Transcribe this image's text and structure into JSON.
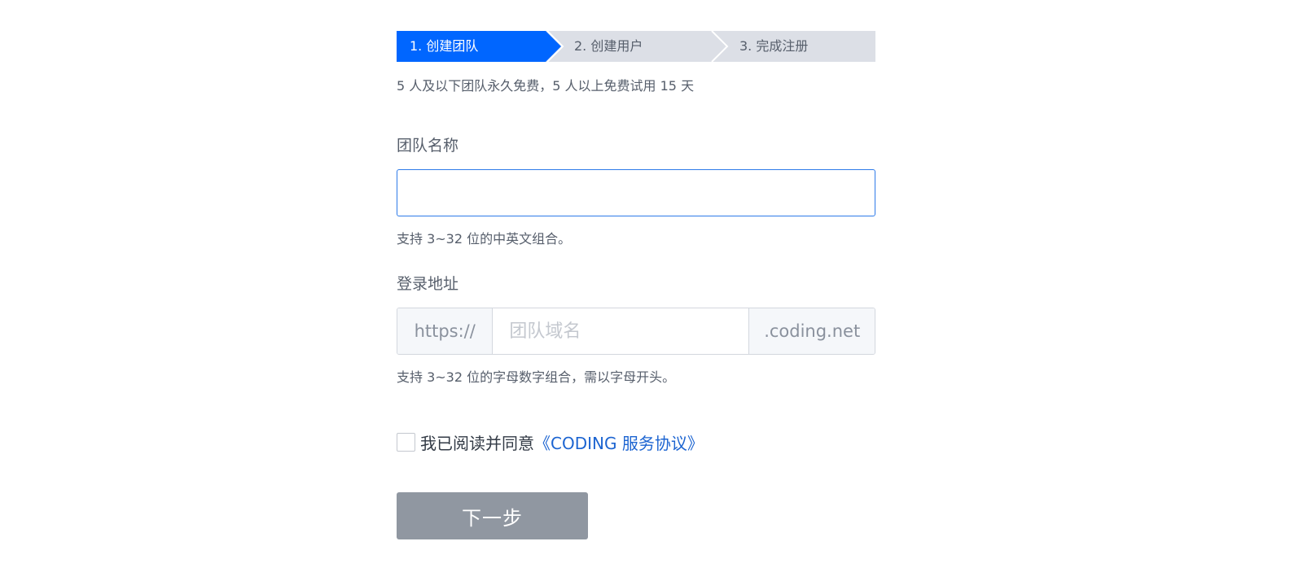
{
  "steps": [
    {
      "label": "1. 创建团队"
    },
    {
      "label": "2. 创建用户"
    },
    {
      "label": "3. 完成注册"
    }
  ],
  "hint_top": "5 人及以下团队永久免费，5 人以上免费试用 15 天",
  "team_name": {
    "label": "团队名称",
    "value": "",
    "help": "支持 3~32 位的中英文组合。"
  },
  "login_url": {
    "label": "登录地址",
    "prefix": "https://",
    "placeholder": "团队域名",
    "suffix": ".coding.net",
    "help": "支持 3~32 位的字母数字组合，需以字母开头。"
  },
  "agreement": {
    "checked": false,
    "text": "我已阅读并同意",
    "link": "《CODING 服务协议》"
  },
  "next_button": "下一步",
  "colors": {
    "active_step": "#0066ff",
    "inactive_step": "#dcdfe6",
    "focus_border": "#2e7be9",
    "link": "#1c64d1",
    "button_disabled": "#9097a1"
  }
}
